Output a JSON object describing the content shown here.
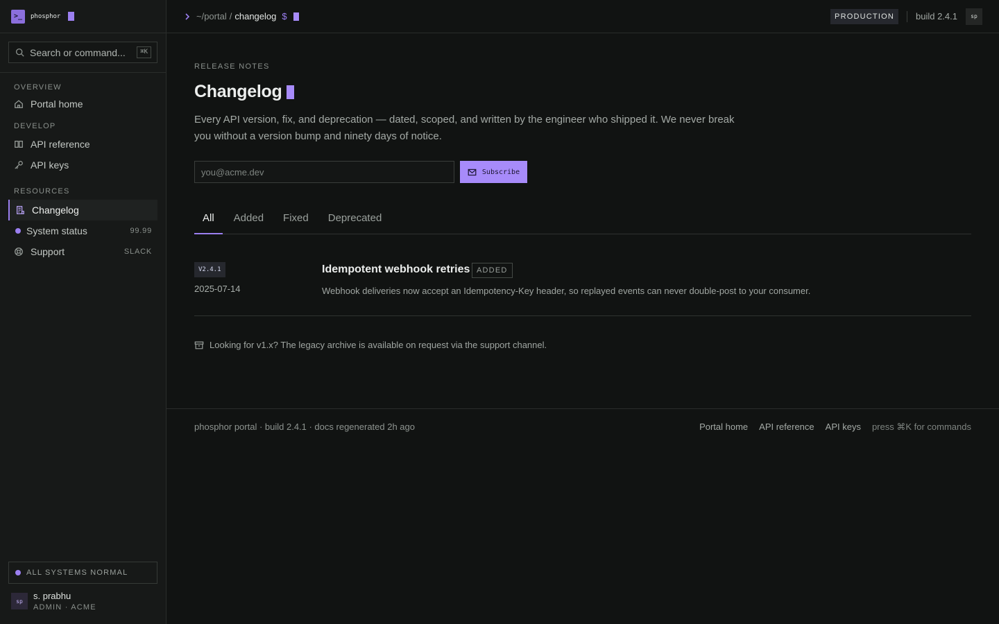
{
  "brand": {
    "name": "phosphor",
    "logo_glyph": ">_"
  },
  "search": {
    "placeholder": "Search or command...",
    "shortcut": "⌘K"
  },
  "nav": {
    "overview": {
      "heading": "OVERVIEW",
      "items": [
        {
          "label": "Portal home",
          "icon": "home-icon"
        }
      ]
    },
    "develop": {
      "heading": "DEVELOP",
      "items": [
        {
          "label": "API reference",
          "icon": "book-icon"
        },
        {
          "label": "API keys",
          "icon": "key-icon"
        }
      ]
    },
    "resources": {
      "heading": "RESOURCES",
      "items": [
        {
          "label": "Changelog",
          "icon": "scroll-icon",
          "active": true
        },
        {
          "label": "System status",
          "icon": "status-dot",
          "meta": "99.99"
        },
        {
          "label": "Support",
          "icon": "lifebuoy-icon",
          "meta": "SLACK"
        }
      ]
    }
  },
  "system_status": "ALL SYSTEMS NORMAL",
  "user": {
    "initials": "sp",
    "name": "s. prabhu",
    "role": "ADMIN · ACME"
  },
  "topbar": {
    "path": "~/portal",
    "separator": "/",
    "current": "changelog",
    "prompt": "$",
    "env": "PRODUCTION",
    "build": "build 2.4.1",
    "avatar": "sp"
  },
  "page": {
    "eyebrow": "RELEASE NOTES",
    "title": "Changelog",
    "lede": "Every API version, fix, and deprecation — dated, scoped, and written by the engineer who shipped it. We never break you without a version bump and ninety days of notice.",
    "email_placeholder": "you@acme.dev",
    "subscribe_label": "Subscribe"
  },
  "tabs": [
    "All",
    "Added",
    "Fixed",
    "Deprecated"
  ],
  "entry": {
    "version": "V2.4.1",
    "date": "2025-07-14",
    "title": "Idempotent webhook retries",
    "tag": "ADDED",
    "description": "Webhook deliveries now accept an Idempotency-Key header, so replayed events can never double-post to your consumer."
  },
  "archive_note": "Looking for v1.x? The legacy archive is available on request via the support channel.",
  "footer": {
    "left": "phosphor portal · build 2.4.1 · docs regenerated 2h ago",
    "links": [
      "Portal home",
      "API reference",
      "API keys"
    ],
    "hint": "press ⌘K for commands"
  },
  "colors": {
    "accent": "#a78bfa",
    "background": "#111312",
    "sidebar": "#171918"
  }
}
